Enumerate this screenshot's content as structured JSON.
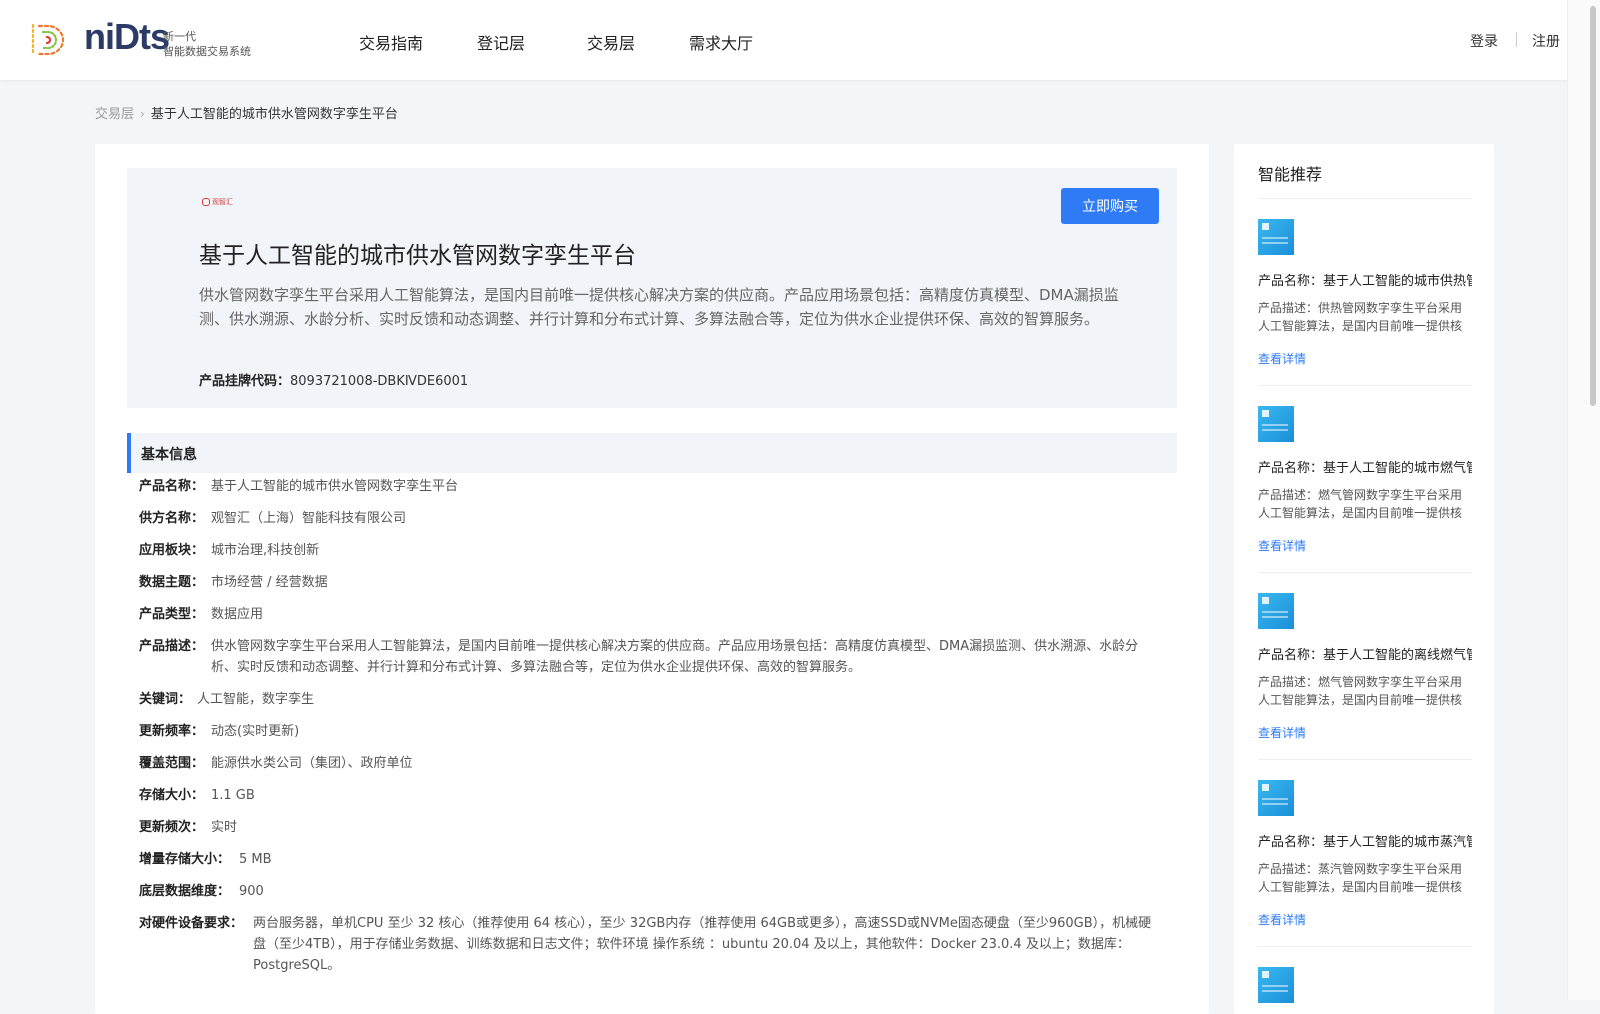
{
  "brand": {
    "wordmark": "niDts",
    "tagline_line1": "新一代",
    "tagline_line2": "智能数据交易系统"
  },
  "nav": {
    "items": [
      "交易指南",
      "登记层",
      "交易层",
      "需求大厅"
    ],
    "login": "登录",
    "register": "注册"
  },
  "breadcrumb": {
    "parent": "交易层",
    "current": "基于人工智能的城市供水管网数字孪生平台"
  },
  "product": {
    "supplier_logo_text": "观智汇",
    "buy_label": "立即购买",
    "title": "基于人工智能的城市供水管网数字孪生平台",
    "description": "供水管网数字孪生平台采用人工智能算法，是国内目前唯一提供核心解决方案的供应商。产品应用场景包括：高精度仿真模型、DMA漏损监测、供水溯源、水龄分析、实时反馈和动态调整、并行计算和分布式计算、多算法融合等，定位为供水企业提供环保、高效的智算服务。",
    "code_label": "产品挂牌代码：",
    "code_value": "8093721008-DBKⅣDE6001"
  },
  "basic_info": {
    "section_title": "基本信息",
    "rows": [
      {
        "label": "产品名称：",
        "value": "基于人工智能的城市供水管网数字孪生平台"
      },
      {
        "label": "供方名称：",
        "value": "观智汇（上海）智能科技有限公司"
      },
      {
        "label": "应用板块：",
        "value": "城市治理,科技创新"
      },
      {
        "label": "数据主题：",
        "value": "市场经营 / 经营数据"
      },
      {
        "label": "产品类型：",
        "value": "数据应用"
      },
      {
        "label": "产品描述：",
        "value": "供水管网数字孪生平台采用人工智能算法，是国内目前唯一提供核心解决方案的供应商。产品应用场景包括：高精度仿真模型、DMA漏损监测、供水溯源、水龄分析、实时反馈和动态调整、并行计算和分布式计算、多算法融合等，定位为供水企业提供环保、高效的智算服务。"
      },
      {
        "label": "关键词：",
        "value": "人工智能，数字孪生"
      },
      {
        "label": "更新频率：",
        "value": "动态(实时更新)"
      },
      {
        "label": "覆盖范围：",
        "value": "能源供水类公司（集团）、政府单位"
      },
      {
        "label": "存储大小：",
        "value": "1.1 GB"
      },
      {
        "label": "更新频次：",
        "value": "实时"
      },
      {
        "label": "增量存储大小：",
        "value": "5 MB"
      },
      {
        "label": "底层数据维度：",
        "value": "900"
      },
      {
        "label": "对硬件设备要求：",
        "value": "两台服务器，单机CPU 至少 32 核心（推荐使用 64 核心），至少 32GB内存（推荐使用 64GB或更多），高速SSD或NVMe固态硬盘（至少960GB），机械硬盘（至少4TB），用于存储业务数据、训练数据和日志文件；软件环境 操作系统 ：ubuntu 20.04 及以上，其他软件：Docker 23.0.4 及以上；数据库：PostgreSQL。"
      }
    ]
  },
  "recommend": {
    "title": "智能推荐",
    "link_label": "查看详情",
    "items": [
      {
        "name": "产品名称：基于人工智能的城市供热管网数字孪生平台",
        "desc": "产品描述：供热管网数字孪生平台采用人工智能算法，是国内目前唯一提供核心解决方案的供应商。"
      },
      {
        "name": "产品名称：基于人工智能的城市燃气管网数字孪生平台",
        "desc": "产品描述：燃气管网数字孪生平台采用人工智能算法，是国内目前唯一提供核心解决方案的供应商。"
      },
      {
        "name": "产品名称：基于人工智能的离线燃气管网数字孪生平台",
        "desc": "产品描述：燃气管网数字孪生平台采用人工智能算法，是国内目前唯一提供核心解决方案的供应商。"
      },
      {
        "name": "产品名称：基于人工智能的城市蒸汽管网数字孪生平台",
        "desc": "产品描述：蒸汽管网数字孪生平台采用人工智能算法，是国内目前唯一提供核心解决方案的供应商。"
      }
    ]
  }
}
